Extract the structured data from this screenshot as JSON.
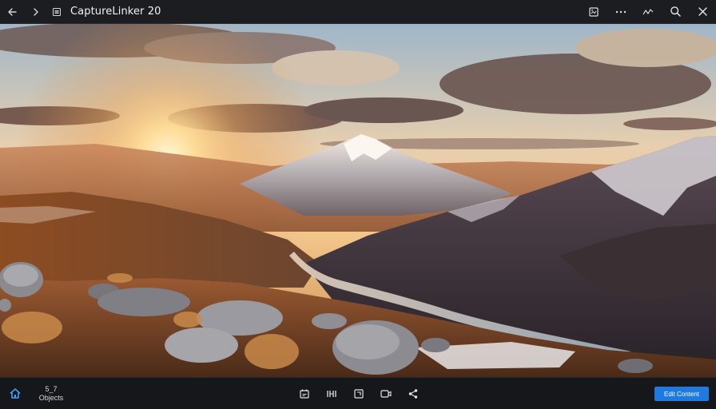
{
  "app": {
    "title": "CaptureLinker 20"
  },
  "topbar": {
    "back_icon": "arrow-left-icon",
    "forward_icon": "chevron-right-icon",
    "menu_icon": "list-icon",
    "right_icons": [
      "image-edit-icon",
      "more-icon",
      "effects-icon",
      "search-icon",
      "close-icon"
    ]
  },
  "bottombar": {
    "objects_count": "5_7",
    "objects_label": "Objects",
    "primary_button_label": "Edit Content",
    "center_icons": [
      "calendar-icon",
      "compare-icon",
      "crop-icon",
      "record-icon",
      "share-icon"
    ],
    "accent_color": "#1f7ae0"
  }
}
